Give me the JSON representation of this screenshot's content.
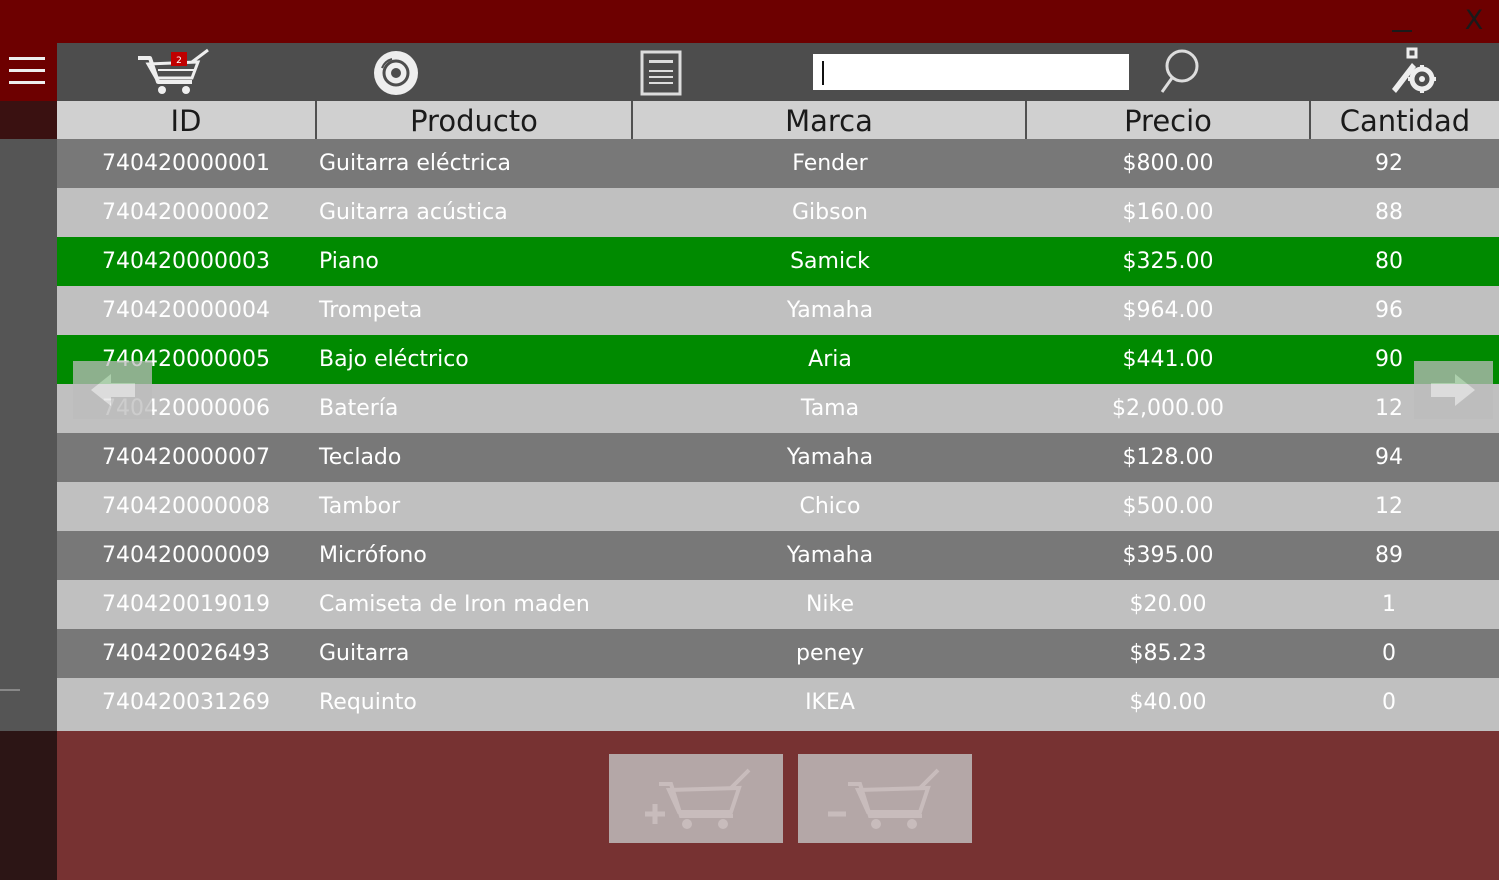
{
  "window": {
    "minimize_label": "_",
    "close_label": "X"
  },
  "toolbar": {
    "cart_badge": "2",
    "search": {
      "value": "",
      "placeholder": ""
    },
    "icons": [
      "menu-icon",
      "shopping-cart-icon",
      "disc-icon",
      "calculator-icon",
      "search-icon",
      "settings-icon"
    ]
  },
  "table": {
    "columns": [
      "ID",
      "Producto",
      "Marca",
      "Precio",
      "Cantidad"
    ],
    "rows": [
      {
        "id": "740420000001",
        "producto": "Guitarra eléctrica",
        "marca": "Fender",
        "precio": "$800.00",
        "cantidad": "92",
        "selected": false
      },
      {
        "id": "740420000002",
        "producto": "Guitarra acústica",
        "marca": "Gibson",
        "precio": "$160.00",
        "cantidad": "88",
        "selected": false
      },
      {
        "id": "740420000003",
        "producto": "Piano",
        "marca": "Samick",
        "precio": "$325.00",
        "cantidad": "80",
        "selected": true
      },
      {
        "id": "740420000004",
        "producto": "Trompeta",
        "marca": "Yamaha",
        "precio": "$964.00",
        "cantidad": "96",
        "selected": false
      },
      {
        "id": "740420000005",
        "producto": "Bajo eléctrico",
        "marca": "Aria",
        "precio": "$441.00",
        "cantidad": "90",
        "selected": true
      },
      {
        "id": "740420000006",
        "producto": "Batería",
        "marca": "Tama",
        "precio": "$2,000.00",
        "cantidad": "12",
        "selected": false
      },
      {
        "id": "740420000007",
        "producto": "Teclado",
        "marca": "Yamaha",
        "precio": "$128.00",
        "cantidad": "94",
        "selected": false
      },
      {
        "id": "740420000008",
        "producto": "Tambor",
        "marca": "Chico",
        "precio": "$500.00",
        "cantidad": "12",
        "selected": false
      },
      {
        "id": "740420000009",
        "producto": "Micrófono",
        "marca": "Yamaha",
        "precio": "$395.00",
        "cantidad": "89",
        "selected": false
      },
      {
        "id": "740420019019",
        "producto": "Camiseta de Iron maden",
        "marca": "Nike",
        "precio": "$20.00",
        "cantidad": "1",
        "selected": false
      },
      {
        "id": "740420026493",
        "producto": "Guitarra",
        "marca": "peney",
        "precio": "$85.23",
        "cantidad": "0",
        "selected": false
      },
      {
        "id": "740420031269",
        "producto": "Requinto",
        "marca": "IKEA",
        "precio": "$40.00",
        "cantidad": "0",
        "selected": false
      }
    ]
  },
  "colors": {
    "title_bar": "#6d0000",
    "toolbar": "#4d4d4d",
    "row_dark": "#787878",
    "row_light": "#c0c0c0",
    "row_selected": "#008a00",
    "bottom_panel": "#773232"
  },
  "bottom": {
    "buttons": [
      "add-to-cart-button",
      "remove-from-cart-button"
    ]
  }
}
